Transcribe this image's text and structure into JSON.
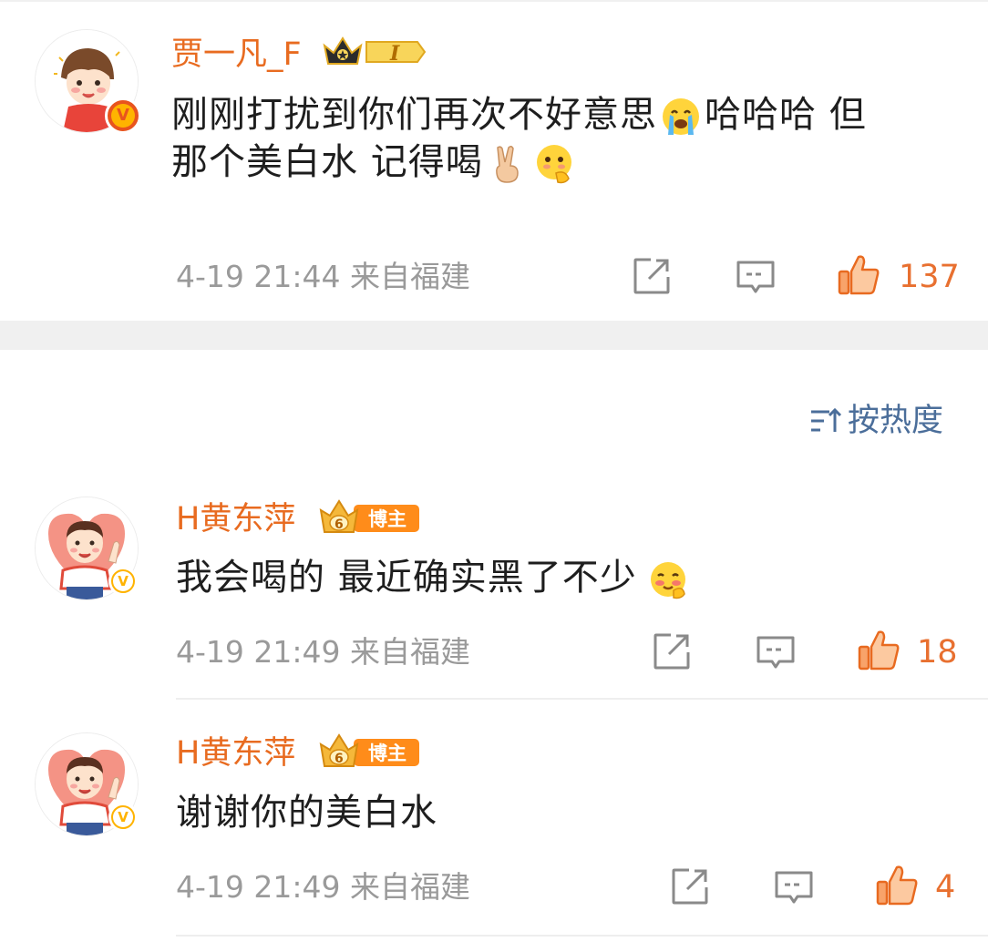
{
  "comments": [
    {
      "username": "贾一凡_F",
      "badge_level": "I",
      "text_parts": [
        "刚刚打扰到你们再次不好意思",
        "哈哈哈 但",
        "那个美白水 记得喝"
      ],
      "emoji": [
        "crying-face",
        "victory-hand",
        "thinking-face"
      ],
      "time": "4-19 21:44",
      "location": "来自福建",
      "likes": "137",
      "verified": "V"
    },
    {
      "username": "H黄东萍",
      "badge_label": "博主",
      "badge_level": "6",
      "text": "我会喝的 最近确实黑了不少",
      "emoji": [
        "blushing-face"
      ],
      "time": "4-19 21:49",
      "location": "来自福建",
      "likes": "18",
      "verified": "V"
    },
    {
      "username": "H黄东萍",
      "badge_label": "博主",
      "badge_level": "6",
      "text": "谢谢你的美白水",
      "time": "4-19 21:49",
      "location": "来自福建",
      "likes": "4",
      "verified": "V"
    }
  ],
  "sort": {
    "label": "按热度",
    "icon": "sort-icon"
  },
  "icons": [
    "share-icon",
    "comment-icon",
    "like-icon"
  ],
  "colors": {
    "username": "#e86b20",
    "meta": "#9a9a9a",
    "like": "#e87030",
    "sort": "#4b6e9a",
    "section_gap": "#f0f0f0"
  }
}
